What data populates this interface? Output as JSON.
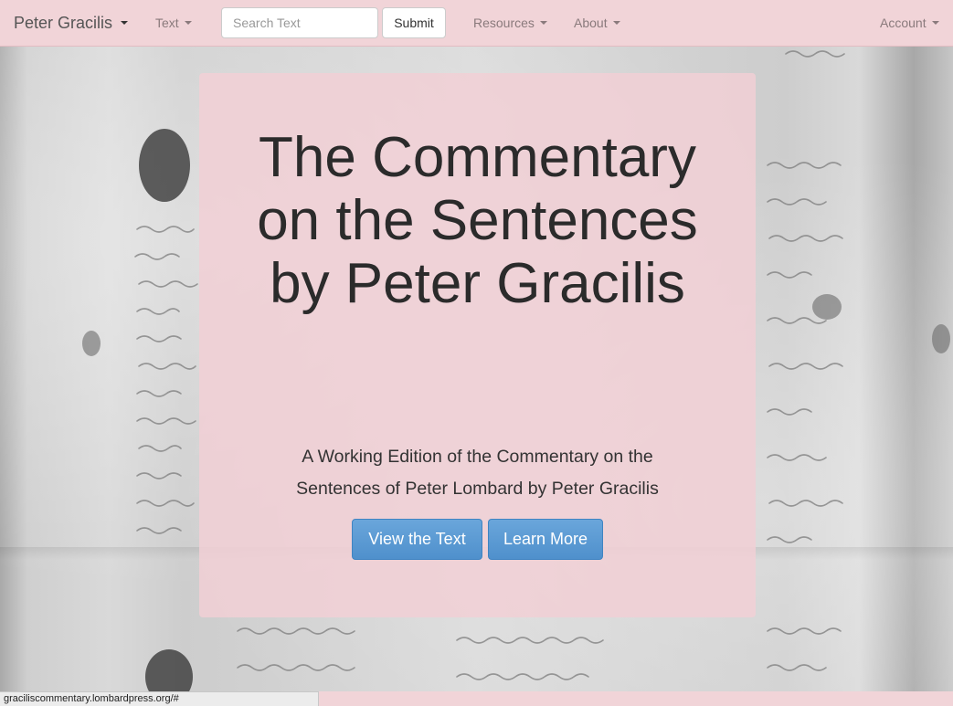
{
  "navbar": {
    "brand": "Peter Gracilis",
    "text_menu": "Text",
    "search_placeholder": "Search Text",
    "submit_label": "Submit",
    "resources_menu": "Resources",
    "about_menu": "About",
    "account_menu": "Account"
  },
  "hero": {
    "title": "The Commentary on the Sentences by Peter Gracilis",
    "subtitle": "A Working Edition of the Commentary on the Sentences of Peter Lombard by Peter Gracilis",
    "view_text_button": "View the Text",
    "learn_more_button": "Learn More"
  },
  "statusbar": {
    "url": "graciliscommentary.lombardpress.org/#"
  },
  "colors": {
    "navbar_bg": "#f1d4d8",
    "hero_bg": "#f1cfd5",
    "button_blue": "#5b9bd5"
  },
  "icons": {
    "dropdown": "caret-down-icon"
  }
}
